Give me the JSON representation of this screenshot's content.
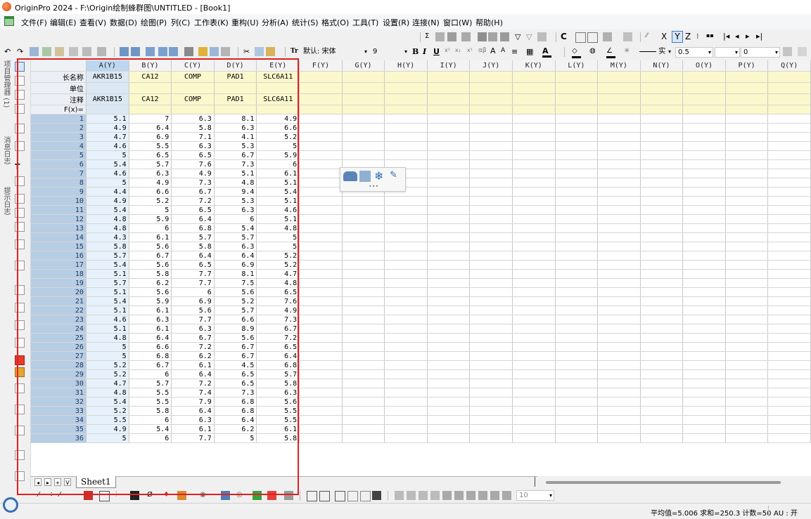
{
  "window": {
    "title": "OriginPro 2024 - F:\\Origin绘制蜂群图\\UNTITLED - [Book1]"
  },
  "menu": [
    "文件(F)",
    "编辑(E)",
    "查看(V)",
    "数据(D)",
    "绘图(P)",
    "列(C)",
    "工作表(K)",
    "重构(U)",
    "分析(A)",
    "统计(S)",
    "格式(O)",
    "工具(T)",
    "设置(R)",
    "连接(N)",
    "窗口(W)",
    "帮助(H)"
  ],
  "format_toolbar": {
    "font_icon": "Tr",
    "font": "默认: 宋体",
    "font_size": "9",
    "bold": "B",
    "italic": "I",
    "underline": "U",
    "line_style": "实",
    "line_width": "0.5",
    "border_width": "0"
  },
  "top_toolbar_letters": {
    "x": "X",
    "y": "Y",
    "z": "Z"
  },
  "left_tabs": [
    "项目管理器 (1)",
    "消息日志",
    "提示日志"
  ],
  "worksheet": {
    "columns": [
      "A(Y)",
      "B(Y)",
      "C(Y)",
      "D(Y)",
      "E(Y)",
      "F(Y)",
      "G(Y)",
      "H(Y)",
      "I(Y)",
      "J(Y)",
      "K(Y)",
      "L(Y)",
      "M(Y)",
      "N(Y)",
      "O(Y)",
      "P(Y)",
      "Q(Y)"
    ],
    "meta_labels": [
      "长名称",
      "单位",
      "注释",
      "F(x)="
    ],
    "long_names": [
      "AKR1B15",
      "CA12",
      "COMP",
      "PAD1",
      "SLC6A11"
    ],
    "units": [
      "",
      "",
      "",
      "",
      ""
    ],
    "comments": [
      "AKR1B15",
      "CA12",
      "COMP",
      "PAD1",
      "SLC6A11"
    ],
    "formulas": [
      "",
      "",
      "",
      "",
      ""
    ],
    "rows": [
      [
        "5.1",
        "7",
        "6.3",
        "8.1",
        "4.9"
      ],
      [
        "4.9",
        "6.4",
        "5.8",
        "6.3",
        "6.6"
      ],
      [
        "4.7",
        "6.9",
        "7.1",
        "4.1",
        "5.2"
      ],
      [
        "4.6",
        "5.5",
        "6.3",
        "5.3",
        "5"
      ],
      [
        "5",
        "6.5",
        "6.5",
        "6.7",
        "5.9"
      ],
      [
        "5.4",
        "5.7",
        "7.6",
        "7.3",
        "6"
      ],
      [
        "4.6",
        "6.3",
        "4.9",
        "5.1",
        "6.1"
      ],
      [
        "5",
        "4.9",
        "7.3",
        "4.8",
        "5.1"
      ],
      [
        "4.4",
        "6.6",
        "6.7",
        "9.4",
        "5.4"
      ],
      [
        "4.9",
        "5.2",
        "7.2",
        "5.3",
        "5.1"
      ],
      [
        "5.4",
        "5",
        "6.5",
        "6.3",
        "4.6"
      ],
      [
        "4.8",
        "5.9",
        "6.4",
        "6",
        "5.1"
      ],
      [
        "4.8",
        "6",
        "6.8",
        "5.4",
        "4.8"
      ],
      [
        "4.3",
        "6.1",
        "5.7",
        "5.7",
        "5"
      ],
      [
        "5.8",
        "5.6",
        "5.8",
        "6.3",
        "5"
      ],
      [
        "5.7",
        "6.7",
        "6.4",
        "6.4",
        "5.2"
      ],
      [
        "5.4",
        "5.6",
        "6.5",
        "6.9",
        "5.2"
      ],
      [
        "5.1",
        "5.8",
        "7.7",
        "8.1",
        "4.7"
      ],
      [
        "5.7",
        "6.2",
        "7.7",
        "7.5",
        "4.8"
      ],
      [
        "5.1",
        "5.6",
        "6",
        "5.6",
        "6.5"
      ],
      [
        "5.4",
        "5.9",
        "6.9",
        "5.2",
        "7.6"
      ],
      [
        "5.1",
        "6.1",
        "5.6",
        "5.7",
        "4.9"
      ],
      [
        "4.6",
        "6.3",
        "7.7",
        "6.6",
        "7.3"
      ],
      [
        "5.1",
        "6.1",
        "6.3",
        "8.9",
        "6.7"
      ],
      [
        "4.8",
        "6.4",
        "6.7",
        "5.6",
        "7.2"
      ],
      [
        "5",
        "6.6",
        "7.2",
        "6.7",
        "6.5"
      ],
      [
        "5",
        "6.8",
        "6.2",
        "6.7",
        "6.4"
      ],
      [
        "5.2",
        "6.7",
        "6.1",
        "4.5",
        "6.8"
      ],
      [
        "5.2",
        "6",
        "6.4",
        "6.5",
        "5.7"
      ],
      [
        "4.7",
        "5.7",
        "7.2",
        "6.5",
        "5.8"
      ],
      [
        "4.8",
        "5.5",
        "7.4",
        "7.3",
        "6.3"
      ],
      [
        "5.4",
        "5.5",
        "7.9",
        "6.8",
        "5.6"
      ],
      [
        "5.2",
        "5.8",
        "6.4",
        "6.8",
        "5.5"
      ],
      [
        "5.5",
        "6",
        "6.3",
        "6.4",
        "5.5"
      ],
      [
        "4.9",
        "5.4",
        "6.1",
        "6.2",
        "6.1"
      ],
      [
        "5",
        "6",
        "7.7",
        "5",
        "5.8"
      ]
    ],
    "row_numbers": [
      "1",
      "2",
      "3",
      "4",
      "5",
      "6",
      "7",
      "8",
      "9",
      "10",
      "11",
      "12",
      "13",
      "14",
      "15",
      "16",
      "17",
      "18",
      "19",
      "20",
      "21",
      "22",
      "23",
      "24",
      "25",
      "26",
      "27",
      "28",
      "29",
      "30",
      "31",
      "32",
      "33",
      "34",
      "35",
      "36"
    ]
  },
  "sheet_tabs": {
    "nav": [
      "◂",
      "▸",
      "+",
      "V"
    ],
    "active": "Sheet1"
  },
  "bottom_toolbar": {
    "zoom_value": "10"
  },
  "status": {
    "stats": "平均值=5.006 求和=250.3 计数=50",
    "au": "AU : 开"
  },
  "colors": {
    "highlight": "#e02020",
    "meta_bg": "#fbf8cc",
    "selected_header": "#bcd7ef",
    "row_header": "#b7cde3"
  }
}
